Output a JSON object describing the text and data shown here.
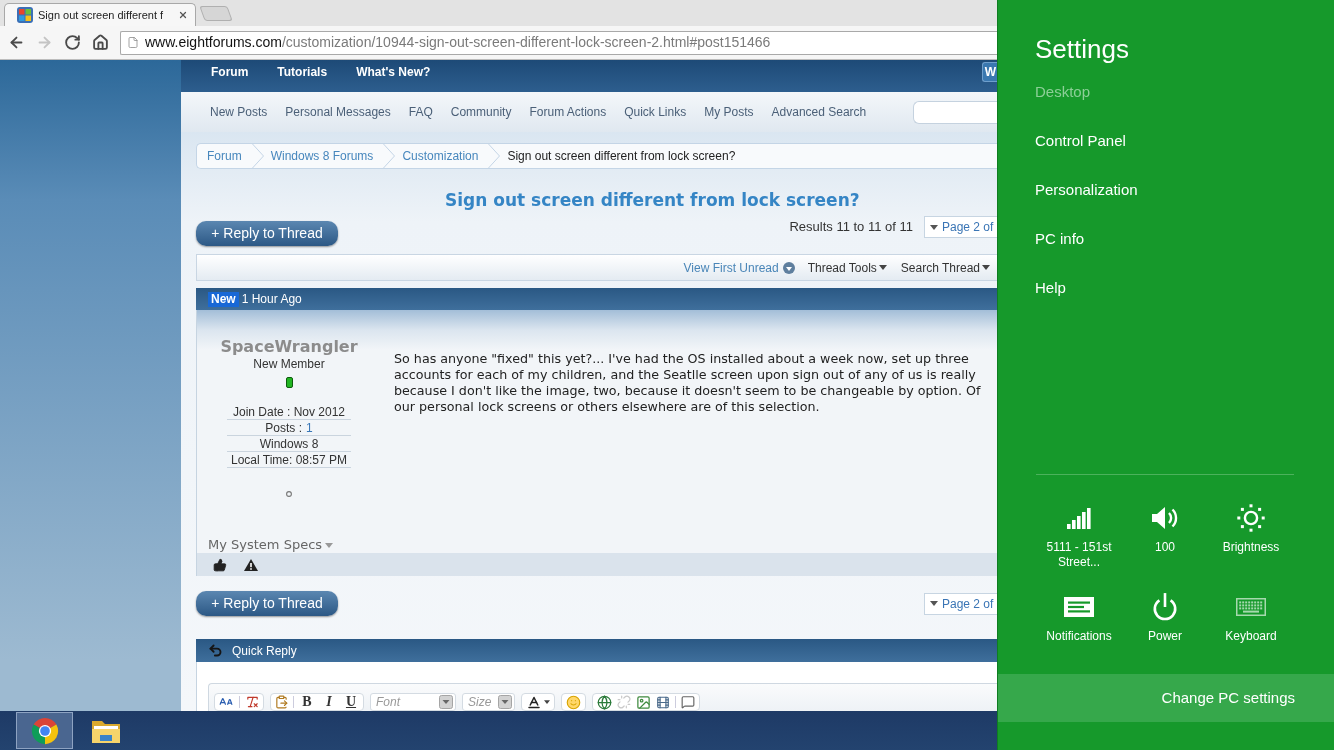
{
  "browser": {
    "tab": {
      "title": "Sign out screen different f",
      "selected": true
    },
    "nav_buttons": [
      {
        "kind": "back",
        "disabled": false
      },
      {
        "kind": "forward",
        "disabled": true
      },
      {
        "kind": "reload",
        "disabled": false
      },
      {
        "kind": "home",
        "disabled": false
      }
    ],
    "address": {
      "host": "www.eightforums.com",
      "path": "/customization/10944-sign-out-screen-different-lock-screen-2.html#post151466"
    }
  },
  "forum": {
    "top_nav": [
      "Forum",
      "Tutorials",
      "What's New?"
    ],
    "top_nav_button": "W",
    "sub_nav": [
      "New Posts",
      "Personal Messages",
      "FAQ",
      "Community",
      "Forum Actions",
      "Quick Links",
      "My Posts",
      "Advanced Search"
    ],
    "breadcrumbs": [
      {
        "label": "Forum",
        "kind": "link"
      },
      {
        "label": "Windows 8 Forums",
        "kind": "link"
      },
      {
        "label": "Customization",
        "kind": "link"
      },
      {
        "label": "Sign out screen different from lock screen?",
        "kind": "current"
      }
    ],
    "thread_title": "Sign out screen different from lock screen?",
    "top_actions": {
      "reply_button": "+ Reply to Thread",
      "results": "Results 11 to 11 of 11",
      "pagination": "Page 2 of"
    },
    "thread_tools": [
      {
        "label": "View First Unread",
        "kind": "link"
      },
      {
        "label": "Thread Tools",
        "kind": "menu"
      },
      {
        "label": "Search Thread",
        "kind": "menu"
      }
    ],
    "post": {
      "badge": "New",
      "time": "1 Hour Ago",
      "author": {
        "name": "SpaceWrangler",
        "rank": "New Member",
        "online": true,
        "stats": [
          {
            "text": "Join Date : Nov 2012"
          },
          {
            "text": "Posts :",
            "link": "1"
          },
          {
            "text": "Windows 8"
          },
          {
            "text": "Local Time: 08:57 PM"
          }
        ]
      },
      "lines": [
        "So has anyone \"fixed\" this yet?... I've had the OS installed about a week now, set up three",
        "accounts for each of my children, and the Seatlle screen upon sign out of any of us is really",
        "because I don't like the image, two, because it doesn't seem to be changeable by option. Of",
        "our personal lock screens or others elsewhere are of this selection."
      ],
      "specs_toggle": "My System Specs"
    },
    "bottom_actions": {
      "reply_button": "+ Reply to Thread",
      "pagination": "Page 2 of"
    },
    "quick_reply": {
      "title": "Quick Reply",
      "format_buttons": [
        {
          "label": "B",
          "kind": "bold"
        },
        {
          "label": "I",
          "kind": "italic"
        },
        {
          "label": "U",
          "kind": "underline"
        }
      ],
      "font_select": {
        "placeholder": "Font"
      },
      "size_select": {
        "placeholder": "Size"
      }
    }
  },
  "taskbar": {
    "apps": [
      {
        "kind": "browser",
        "selected": true
      },
      {
        "kind": "folder",
        "selected": false
      }
    ]
  },
  "settings": {
    "title": "Settings",
    "items": [
      {
        "label": "Desktop",
        "disabled": true
      },
      {
        "label": "Control Panel",
        "disabled": false
      },
      {
        "label": "Personalization",
        "disabled": false
      },
      {
        "label": "PC info",
        "disabled": false
      },
      {
        "label": "Help",
        "disabled": false
      }
    ],
    "quick_settings": [
      {
        "kind": "network",
        "label": "5111 - 151st Street...",
        "disabled": false
      },
      {
        "kind": "volume",
        "label": "100",
        "disabled": false
      },
      {
        "kind": "brightness",
        "label": "Brightness",
        "disabled": false
      },
      {
        "kind": "notifications",
        "label": "Notifications",
        "disabled": false
      },
      {
        "kind": "power",
        "label": "Power",
        "disabled": false
      },
      {
        "kind": "keyboard",
        "label": "Keyboard",
        "disabled": true
      }
    ],
    "change_button": "Change PC settings"
  }
}
